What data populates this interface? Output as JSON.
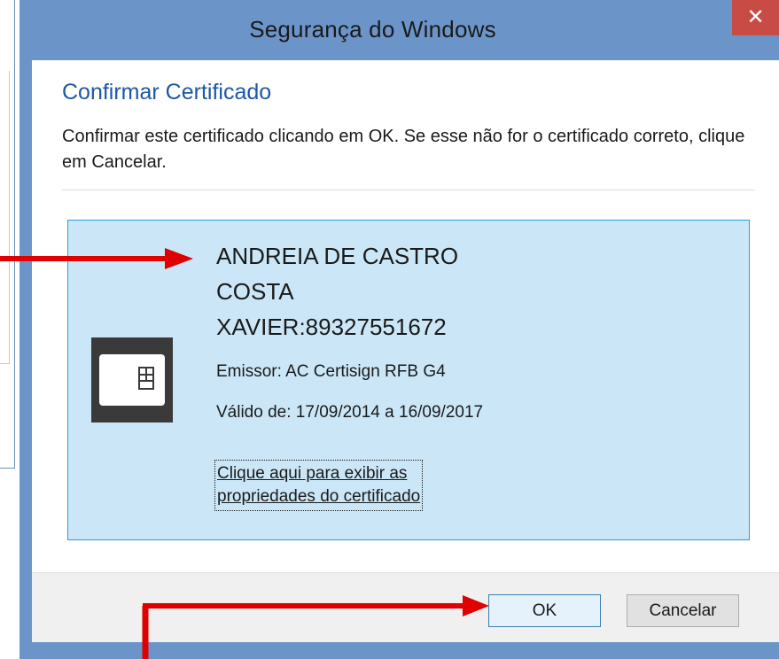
{
  "window": {
    "title": "Segurança do Windows",
    "close_glyph": "✕"
  },
  "dialog": {
    "heading": "Confirmar Certificado",
    "description": "Confirmar este certificado clicando em OK. Se esse não for o certificado correto, clique em Cancelar."
  },
  "certificate": {
    "name_lines": [
      "ANDREIA DE CASTRO",
      "COSTA",
      "XAVIER:89327551672"
    ],
    "issuer": "Emissor: AC Certisign RFB G4",
    "validity": "Válido de: 17/09/2014 a 16/09/2017",
    "link_lines": [
      "Clique aqui para exibir as",
      "propriedades do certificado"
    ],
    "icon": "smartcard-icon"
  },
  "buttons": {
    "ok": "OK",
    "cancel": "Cancelar"
  },
  "colors": {
    "frame": "#6b95c9",
    "close": "#c94b45",
    "heading": "#1e57a5",
    "cert_background": "#cbe7f7",
    "cert_border": "#26a0da",
    "annotation": "#e00000"
  }
}
